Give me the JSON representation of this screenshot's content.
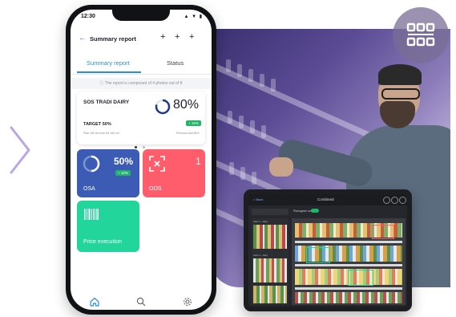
{
  "phone": {
    "time": "12:30",
    "signal_icons": "▲ ▼ ▮",
    "header_title": "Summary report",
    "tabs": [
      "Summary report",
      "Status"
    ],
    "info_text": "The report is composed of 4 photos out of 8",
    "main_card": {
      "title": "SOS TRADI DAIRY",
      "percent": "80%",
      "target": "TARGET 50%",
      "delta": "+ 15%",
      "left_note": "Plan 150 cm from 83 160 cm",
      "right_note": "Previous visit 65%"
    },
    "osa": {
      "label": "OSA",
      "percent": "50%",
      "delta": "+ 10%"
    },
    "oos": {
      "label": "OOS",
      "count": "1"
    },
    "price": {
      "label": "Price execution"
    }
  },
  "tablet": {
    "back_label": "< Back",
    "title": "Combined",
    "toggle_label": "Planogram overlay",
    "list_labels": [
      "Aisle 1 - dairy",
      "Aisle 2 - dairy"
    ]
  },
  "colors": {
    "accent": "#2a8fd6",
    "osa_tile": "#3b5bb5",
    "oos_tile": "#ff5d6c",
    "price_tile": "#21d59b",
    "success": "#21b36a",
    "hero_purple": "#3a3070",
    "chevron": "#b9a6e6"
  },
  "icons": [
    "back-arrow-icon",
    "plus-icon",
    "info-icon",
    "donut-progress-icon",
    "scan-x-icon",
    "barcode-icon",
    "home-icon",
    "search-icon",
    "settings-icon",
    "grid-icon",
    "chevron-right-icon"
  ]
}
